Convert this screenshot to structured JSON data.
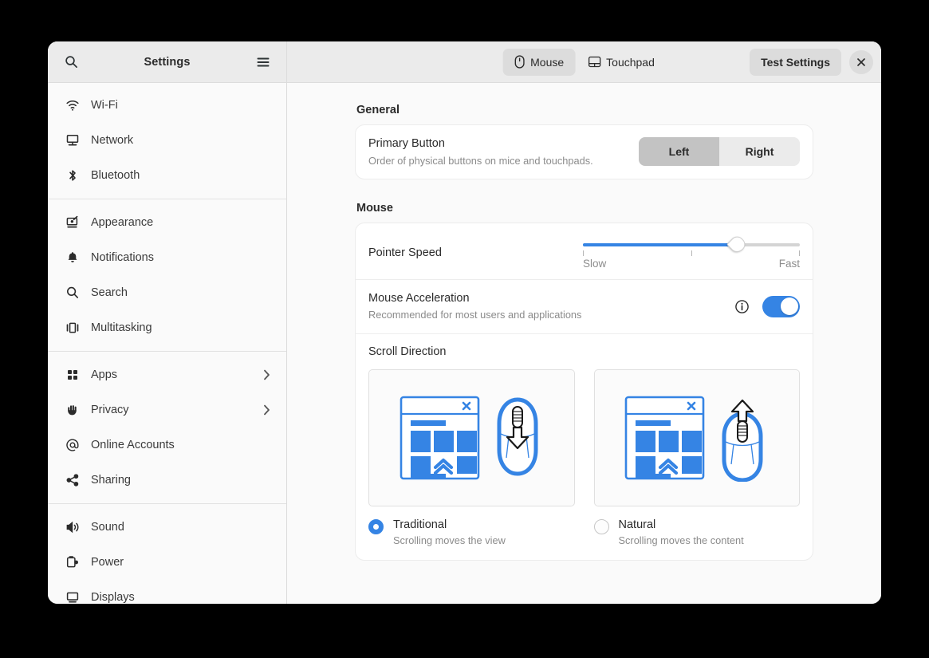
{
  "window": {
    "app_title": "Settings",
    "search_icon": "search-icon",
    "menu_icon": "hamburger-menu-icon",
    "close_icon": "close-icon"
  },
  "header": {
    "view_switcher": [
      {
        "label": "Mouse",
        "icon": "mouse-icon",
        "selected": true
      },
      {
        "label": "Touchpad",
        "icon": "touchpad-icon",
        "selected": false
      }
    ],
    "test_settings_label": "Test Settings"
  },
  "sidebar": {
    "groups": [
      {
        "items": [
          {
            "label": "Wi-Fi",
            "icon": "wifi-icon",
            "chevron": false
          },
          {
            "label": "Network",
            "icon": "network-icon",
            "chevron": false
          },
          {
            "label": "Bluetooth",
            "icon": "bluetooth-icon",
            "chevron": false
          }
        ]
      },
      {
        "items": [
          {
            "label": "Appearance",
            "icon": "appearance-icon",
            "chevron": false
          },
          {
            "label": "Notifications",
            "icon": "bell-icon",
            "chevron": false
          },
          {
            "label": "Search",
            "icon": "search-icon",
            "chevron": false
          },
          {
            "label": "Multitasking",
            "icon": "multitasking-icon",
            "chevron": false
          }
        ]
      },
      {
        "items": [
          {
            "label": "Apps",
            "icon": "apps-grid-icon",
            "chevron": true
          },
          {
            "label": "Privacy",
            "icon": "hand-icon",
            "chevron": true
          },
          {
            "label": "Online Accounts",
            "icon": "at-sign-icon",
            "chevron": false
          },
          {
            "label": "Sharing",
            "icon": "share-icon",
            "chevron": false
          }
        ]
      },
      {
        "items": [
          {
            "label": "Sound",
            "icon": "speaker-icon",
            "chevron": false
          },
          {
            "label": "Power",
            "icon": "battery-icon",
            "chevron": false
          },
          {
            "label": "Displays",
            "icon": "display-icon",
            "chevron": false
          }
        ]
      }
    ]
  },
  "main": {
    "general": {
      "title": "General",
      "primary_button": {
        "title": "Primary Button",
        "subtitle": "Order of physical buttons on mice and touchpads.",
        "options": [
          {
            "label": "Left",
            "selected": true
          },
          {
            "label": "Right",
            "selected": false
          }
        ]
      }
    },
    "mouse": {
      "title": "Mouse",
      "pointer_speed": {
        "title": "Pointer Speed",
        "min_label": "Slow",
        "max_label": "Fast",
        "value_percent": 71
      },
      "mouse_acceleration": {
        "title": "Mouse Acceleration",
        "subtitle": "Recommended for most users and applications",
        "info_icon": "info-icon",
        "enabled": true
      },
      "scroll_direction": {
        "title": "Scroll Direction",
        "options": [
          {
            "label": "Traditional",
            "sublabel": "Scrolling moves the view",
            "selected": true,
            "arrow": "down"
          },
          {
            "label": "Natural",
            "sublabel": "Scrolling moves the content",
            "selected": false,
            "arrow": "up"
          }
        ]
      }
    }
  },
  "colors": {
    "accent": "#3584e4",
    "headerbar": "#ebebeb",
    "window_bg": "#fafafa",
    "card_bg": "#ffffff",
    "selected_segment": "#c3c3c3"
  }
}
